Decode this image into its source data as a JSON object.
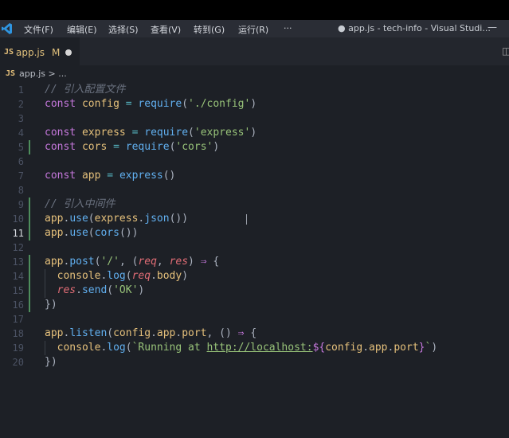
{
  "titlebar": {
    "menus": [
      "文件(F)",
      "编辑(E)",
      "选择(S)",
      "查看(V)",
      "转到(G)",
      "运行(R)",
      "···"
    ],
    "window_title": "● app.js - tech-info - Visual Studi...",
    "minimize": "—"
  },
  "tab": {
    "name": "app.js",
    "status": "M",
    "icon": "JS"
  },
  "breadcrumb": {
    "file": "app.js",
    "separator": ">",
    "more": "..."
  },
  "colors": {
    "background": "#1d2026",
    "titlebar": "#2a2d35",
    "accent": "#61afef",
    "git_modified": "#4e8e5c"
  },
  "editor": {
    "active_line": 11,
    "lines": [
      {
        "n": "1",
        "t": [
          [
            "com",
            "// 引入配置文件"
          ]
        ]
      },
      {
        "n": "2",
        "t": [
          [
            "kw",
            "const "
          ],
          [
            "var",
            "config"
          ],
          [
            "op",
            " = "
          ],
          [
            "fn",
            "require"
          ],
          [
            "pun",
            "("
          ],
          [
            "str",
            "'./config'"
          ],
          [
            "pun",
            ")"
          ]
        ]
      },
      {
        "n": "3",
        "t": []
      },
      {
        "n": "4",
        "t": [
          [
            "kw",
            "const "
          ],
          [
            "var",
            "express"
          ],
          [
            "op",
            " = "
          ],
          [
            "fn",
            "require"
          ],
          [
            "pun",
            "("
          ],
          [
            "str",
            "'express'"
          ],
          [
            "pun",
            ")"
          ]
        ]
      },
      {
        "n": "5",
        "t": [
          [
            "kw",
            "const "
          ],
          [
            "var",
            "cors"
          ],
          [
            "op",
            " = "
          ],
          [
            "fn",
            "require"
          ],
          [
            "pun",
            "("
          ],
          [
            "str",
            "'cors'"
          ],
          [
            "pun",
            ")"
          ]
        ]
      },
      {
        "n": "6",
        "t": []
      },
      {
        "n": "7",
        "t": [
          [
            "kw",
            "const "
          ],
          [
            "var",
            "app"
          ],
          [
            "op",
            " = "
          ],
          [
            "fn",
            "express"
          ],
          [
            "pun",
            "()"
          ]
        ]
      },
      {
        "n": "8",
        "t": []
      },
      {
        "n": "9",
        "t": [
          [
            "com",
            "// 引入中间件"
          ]
        ]
      },
      {
        "n": "10",
        "t": [
          [
            "var",
            "app"
          ],
          [
            "pun",
            "."
          ],
          [
            "fn",
            "use"
          ],
          [
            "pun",
            "("
          ],
          [
            "var",
            "express"
          ],
          [
            "pun",
            "."
          ],
          [
            "fn",
            "json"
          ],
          [
            "pun",
            "())"
          ]
        ]
      },
      {
        "n": "11",
        "t": [
          [
            "var",
            "app"
          ],
          [
            "pun",
            "."
          ],
          [
            "fn",
            "use"
          ],
          [
            "pun",
            "("
          ],
          [
            "fn",
            "cors"
          ],
          [
            "pun",
            "())"
          ]
        ]
      },
      {
        "n": "12",
        "t": []
      },
      {
        "n": "13",
        "t": [
          [
            "var",
            "app"
          ],
          [
            "pun",
            "."
          ],
          [
            "fn",
            "post"
          ],
          [
            "pun",
            "("
          ],
          [
            "str",
            "'/'"
          ],
          [
            "pun",
            ", ("
          ],
          [
            "par",
            "req"
          ],
          [
            "pun",
            ", "
          ],
          [
            "par",
            "res"
          ],
          [
            "pun",
            ") "
          ],
          [
            "kw",
            "⇒"
          ],
          [
            "pun",
            " {"
          ]
        ]
      },
      {
        "n": "14",
        "t": [
          [
            "pun",
            "  "
          ],
          [
            "var",
            "console"
          ],
          [
            "pun",
            "."
          ],
          [
            "fn",
            "log"
          ],
          [
            "pun",
            "("
          ],
          [
            "par",
            "req"
          ],
          [
            "pun",
            "."
          ],
          [
            "prop",
            "body"
          ],
          [
            "pun",
            ")"
          ]
        ]
      },
      {
        "n": "15",
        "t": [
          [
            "pun",
            "  "
          ],
          [
            "par",
            "res"
          ],
          [
            "pun",
            "."
          ],
          [
            "fn",
            "send"
          ],
          [
            "pun",
            "("
          ],
          [
            "str",
            "'OK'"
          ],
          [
            "pun",
            ")"
          ]
        ]
      },
      {
        "n": "16",
        "t": [
          [
            "pun",
            "})"
          ]
        ]
      },
      {
        "n": "17",
        "t": []
      },
      {
        "n": "18",
        "t": [
          [
            "var",
            "app"
          ],
          [
            "pun",
            "."
          ],
          [
            "fn",
            "listen"
          ],
          [
            "pun",
            "("
          ],
          [
            "var",
            "config"
          ],
          [
            "pun",
            "."
          ],
          [
            "prop",
            "app"
          ],
          [
            "pun",
            "."
          ],
          [
            "prop",
            "port"
          ],
          [
            "pun",
            ", () "
          ],
          [
            "kw",
            "⇒"
          ],
          [
            "pun",
            " {"
          ]
        ]
      },
      {
        "n": "19",
        "t": [
          [
            "pun",
            "  "
          ],
          [
            "var",
            "console"
          ],
          [
            "pun",
            "."
          ],
          [
            "fn",
            "log"
          ],
          [
            "pun",
            "("
          ],
          [
            "str",
            "`Running at "
          ],
          [
            "url",
            "http://localhost:"
          ],
          [
            "kw",
            "${"
          ],
          [
            "var",
            "config"
          ],
          [
            "pun",
            "."
          ],
          [
            "prop",
            "app"
          ],
          [
            "pun",
            "."
          ],
          [
            "prop",
            "port"
          ],
          [
            "kw",
            "}"
          ],
          [
            "str",
            "`"
          ],
          [
            "pun",
            ")"
          ]
        ]
      },
      {
        "n": "20",
        "t": [
          [
            "pun",
            "})"
          ]
        ]
      }
    ]
  }
}
